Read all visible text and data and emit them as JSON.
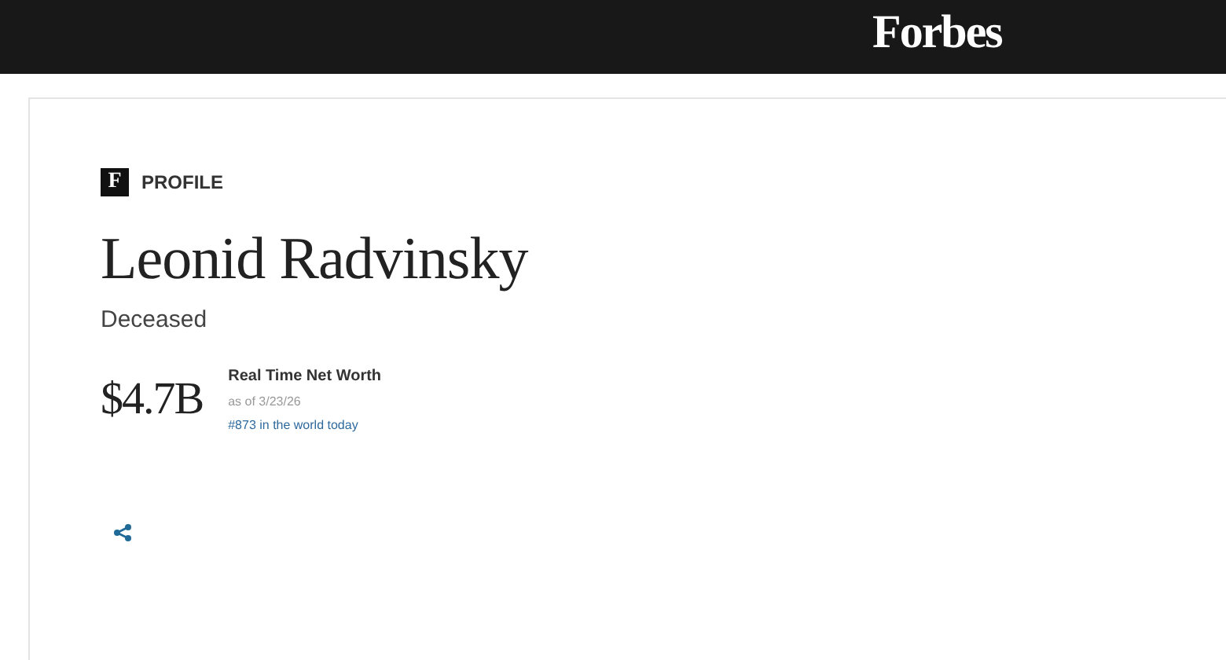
{
  "header": {
    "logo": "Forbes"
  },
  "profile": {
    "badge": "F",
    "label": "PROFILE",
    "name": "Leonid Radvinsky",
    "status": "Deceased",
    "net_worth": {
      "value": "$4.7B",
      "title": "Real Time Net Worth",
      "as_of": "as of 3/23/26",
      "rank": "#873 in the world today"
    }
  }
}
